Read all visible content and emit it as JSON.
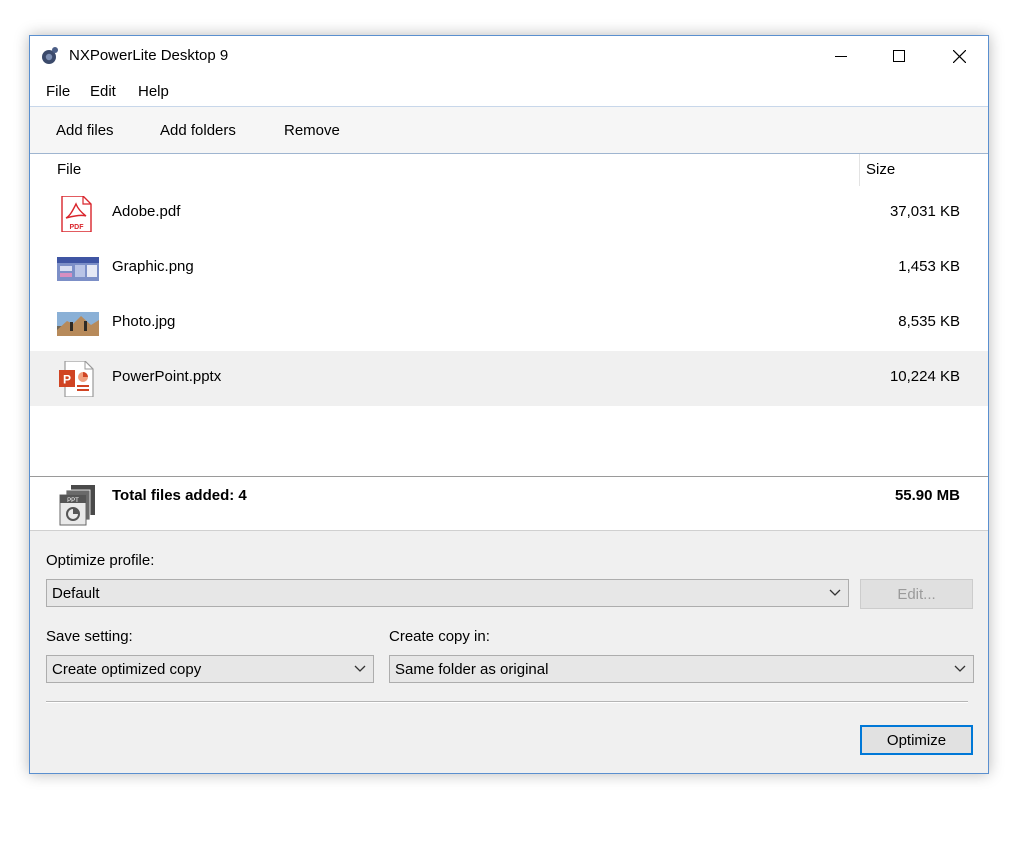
{
  "window": {
    "title": "NXPowerLite Desktop 9",
    "icons": {
      "app": "nxpowerlite-app-icon",
      "minimize": "minimize-icon",
      "maximize": "maximize-icon",
      "close": "close-icon"
    }
  },
  "menu": {
    "items": [
      "File",
      "Edit",
      "Help"
    ]
  },
  "toolbar": {
    "add_files": "Add files",
    "add_folders": "Add folders",
    "remove": "Remove"
  },
  "file_list": {
    "columns": {
      "file": "File",
      "size": "Size"
    },
    "rows": [
      {
        "name": "Adobe.pdf",
        "size": "37,031 KB",
        "icon": "pdf-file-icon",
        "selected": false
      },
      {
        "name": "Graphic.png",
        "size": "1,453 KB",
        "icon": "png-thumbnail-icon",
        "selected": false
      },
      {
        "name": "Photo.jpg",
        "size": "8,535 KB",
        "icon": "jpg-thumbnail-icon",
        "selected": false
      },
      {
        "name": "PowerPoint.pptx",
        "size": "10,224 KB",
        "icon": "pptx-file-icon",
        "selected": true
      }
    ],
    "total": {
      "label": "Total files added: 4",
      "size": "55.90 MB",
      "icon": "file-stack-icon"
    }
  },
  "options": {
    "optimize_profile_label": "Optimize profile:",
    "optimize_profile_value": "Default",
    "edit_button": "Edit...",
    "save_setting_label": "Save setting:",
    "save_setting_value": "Create optimized copy",
    "create_copy_label": "Create copy in:",
    "create_copy_value": "Same folder as original",
    "optimize_button": "Optimize"
  },
  "colors": {
    "accent": "#0078d7",
    "window_border": "#5a8fcf",
    "pdf_red": "#d9252c",
    "ppt_orange": "#d04423"
  }
}
